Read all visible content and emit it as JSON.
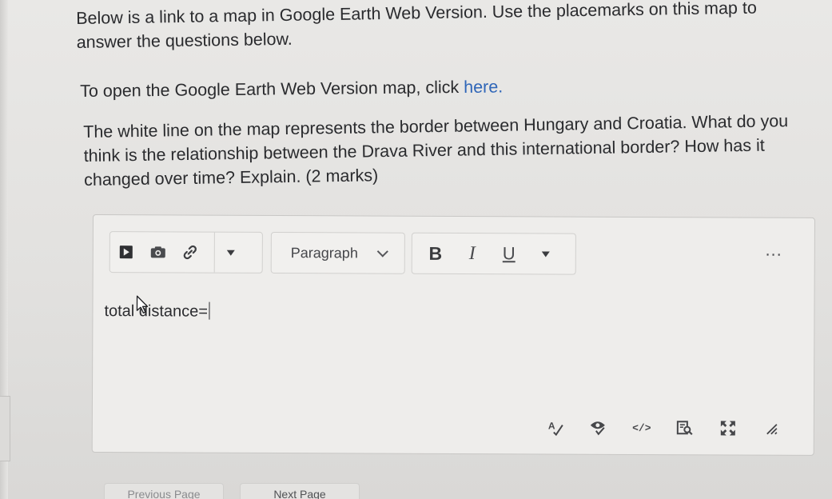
{
  "intro_text": "Below is a link to a map in Google Earth Web Version. Use the placemarks on this map to answer the questions below.",
  "open_text": "To open the Google Earth Web Version map, click ",
  "open_link": "here.",
  "question_text": "The white line on the map represents the border between Hungary and Croatia. What do you think is the relationship between the Drava River and this international border? How has it changed over time? Explain. (2 marks)",
  "editor": {
    "paragraph_label": "Paragraph",
    "bold_label": "B",
    "italic_label": "I",
    "underline_label": "U",
    "more_label": "...",
    "content_text": "total distance=",
    "code_label": "</>"
  },
  "bottom": {
    "previous_label": "Previous Page",
    "next_label": "Next Page"
  }
}
